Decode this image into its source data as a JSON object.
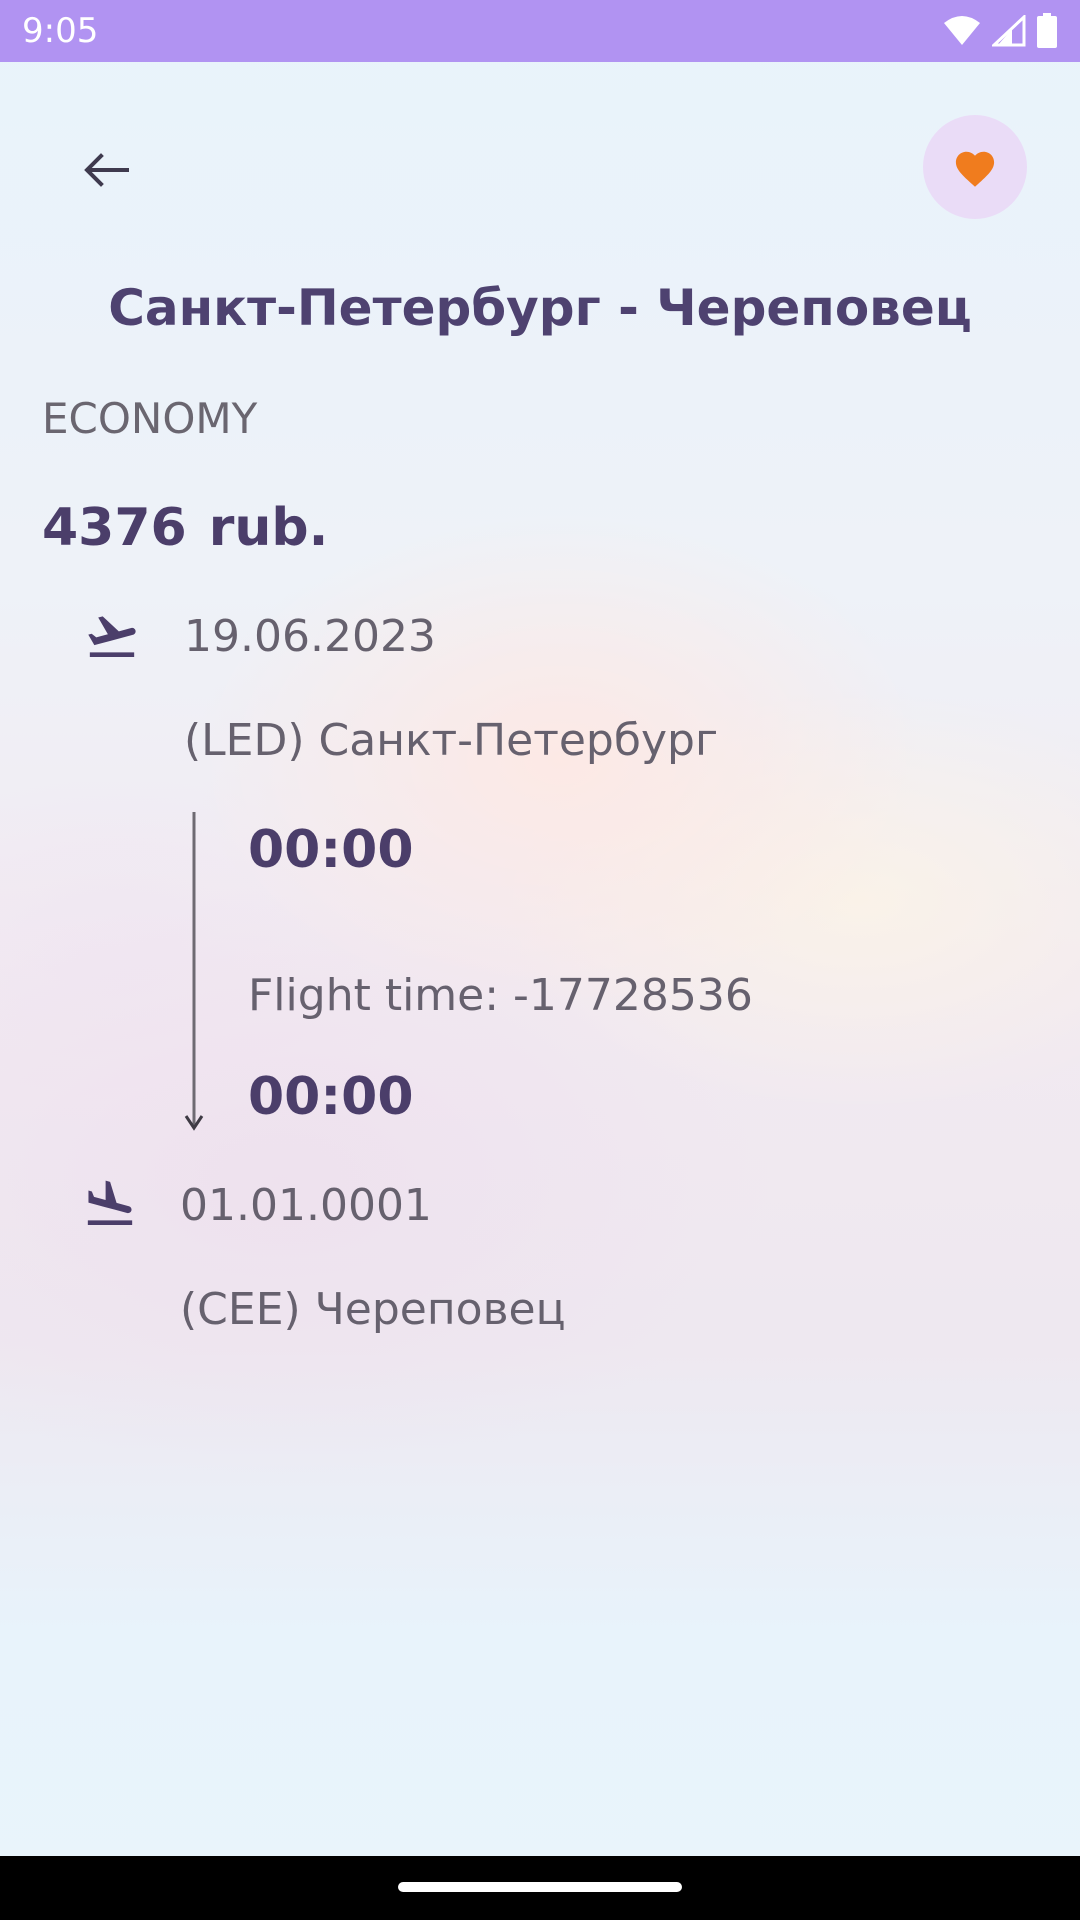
{
  "status_bar": {
    "time": "9:05",
    "icons": [
      "wifi-icon",
      "signal-icon",
      "battery-icon"
    ],
    "background": "#b193f2"
  },
  "toolbar": {
    "back_icon": "arrow-left-icon",
    "favorite_icon": "heart-icon",
    "favorite_color": "#f07c1e"
  },
  "flight": {
    "route_title": "Санкт-Петербург - Череповец",
    "class": "ECONOMY",
    "price_amount": "4376",
    "price_currency": "rub.",
    "departure": {
      "date": "19.06.2023",
      "airport": "(LED) Санкт-Петербург",
      "time": "00:00"
    },
    "flight_time": "Flight time: -17728536",
    "arrival": {
      "time": "00:00",
      "date": "01.01.0001",
      "airport": "(CEE) Череповец"
    }
  },
  "colors": {
    "accent": "#4b3e6a",
    "text_secondary": "#66616e",
    "fav_button_bg": "#eadcf7"
  }
}
